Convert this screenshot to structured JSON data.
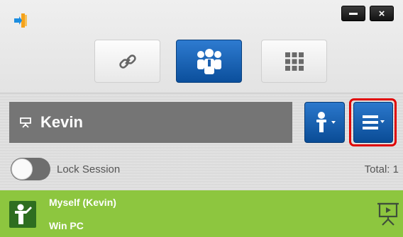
{
  "window": {
    "app_icon": "app-logo-icon",
    "minimize_icon": "minimize-icon",
    "close_label": "×"
  },
  "tabs": [
    {
      "icon": "link-icon",
      "selected": false
    },
    {
      "icon": "users-icon",
      "selected": true
    },
    {
      "icon": "grid-icon",
      "selected": false
    }
  ],
  "session": {
    "user_name": "Kevin",
    "lock_label": "Lock Session",
    "lock_enabled": false,
    "total_label": "Total: 1"
  },
  "participants": [
    {
      "name": "Myself (Kevin)",
      "device": "Win PC",
      "avatar_icon": "presenter-icon",
      "action_icon": "present-screen-icon"
    }
  ],
  "colors": {
    "accent_blue": "#1d64b6",
    "participant_green": "#8dc63f",
    "highlight_red": "#e00000",
    "user_bar_gray": "#757575"
  }
}
